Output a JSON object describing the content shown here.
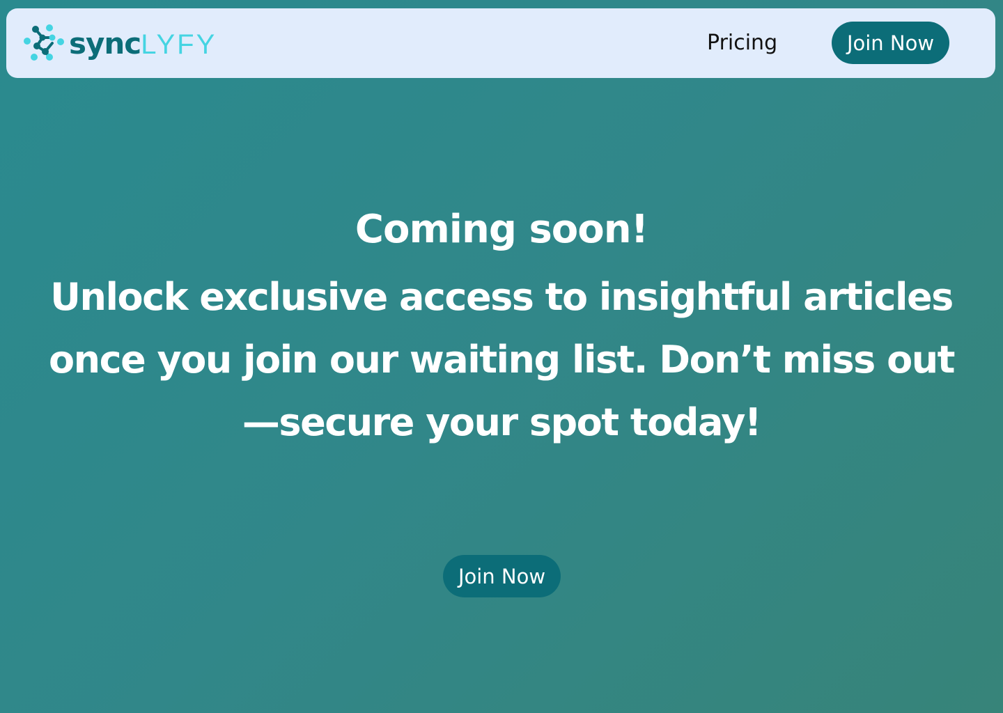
{
  "brand": {
    "name_dark": "sync",
    "name_light": "LYFY",
    "logo_icon": "molecule-nodes-icon",
    "colors": {
      "dark": "#0c6d78",
      "light": "#45d4e2"
    }
  },
  "nav": {
    "pricing_label": "Pricing",
    "join_label": "Join Now"
  },
  "hero": {
    "title": "Coming soon!",
    "subtitle": "Unlock exclusive access to insightful articles once you join our waiting list. Don’t miss out —secure your spot today!"
  },
  "cta": {
    "join_label": "Join Now"
  },
  "colors": {
    "navbar_bg": "#e1ecfc",
    "button_bg": "#0c6d78",
    "page_bg_start": "#2a8a8f",
    "page_bg_end": "#378479",
    "text_light": "#ffffff"
  }
}
